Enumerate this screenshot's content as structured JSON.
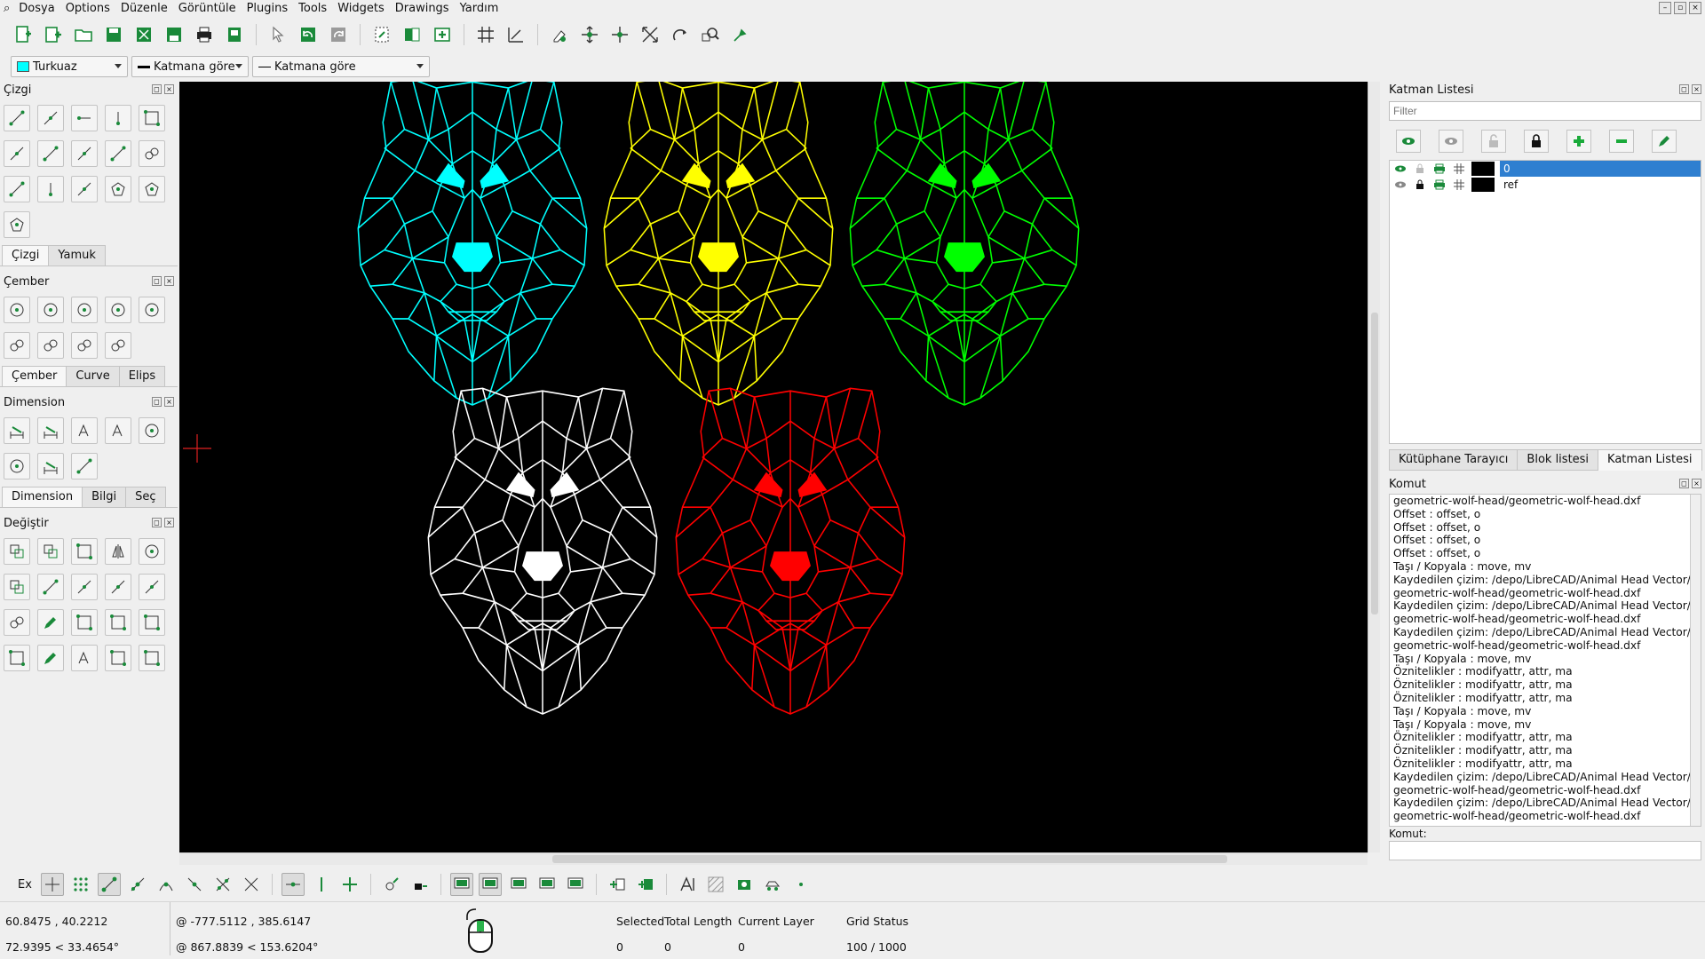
{
  "menu": [
    "Dosya",
    "Options",
    "Düzenle",
    "Görüntüle",
    "Plugins",
    "Tools",
    "Widgets",
    "Drawings",
    "Yardım"
  ],
  "toolbar2": {
    "color": "Turkuaz",
    "color_hex": "#00ffff",
    "linewidth": "Katmana göre",
    "linetype": "Katmana göre"
  },
  "left_dock": {
    "cizgi_title": "Çizgi",
    "cizgi_tabs": [
      "Çizgi",
      "Yamuk"
    ],
    "cember_title": "Çember",
    "cember_tabs": [
      "Çember",
      "Curve",
      "Elips"
    ],
    "dimension_title": "Dimension",
    "dimension_tabs": [
      "Dimension",
      "Bilgi",
      "Seç"
    ],
    "degistir_title": "Değiştir"
  },
  "layers": {
    "title": "Katman Listesi",
    "filter_placeholder": "Filter",
    "rows": [
      {
        "name": "0",
        "selected": true
      },
      {
        "name": "ref",
        "selected": false
      }
    ],
    "tabs": [
      "Kütüphane Tarayıcı",
      "Blok listesi",
      "Katman Listesi"
    ]
  },
  "command": {
    "title": "Komut",
    "log": [
      "geometric-wolf-head/geometric-wolf-head.dxf",
      "Offset : offset, o",
      "Offset : offset, o",
      "Offset : offset, o",
      "Offset : offset, o",
      "Taşı / Kopyala : move, mv",
      "Kaydedilen çizim: /depo/LibreCAD/Animal Head Vector/",
      "geometric-wolf-head/geometric-wolf-head.dxf",
      "Kaydedilen çizim: /depo/LibreCAD/Animal Head Vector/",
      "geometric-wolf-head/geometric-wolf-head.dxf",
      "Kaydedilen çizim: /depo/LibreCAD/Animal Head Vector/",
      "geometric-wolf-head/geometric-wolf-head.dxf",
      "Taşı / Kopyala : move, mv",
      "Öznitelikler : modifyattr, attr, ma",
      "Öznitelikler : modifyattr, attr, ma",
      "Öznitelikler : modifyattr, attr, ma",
      "Taşı / Kopyala : move, mv",
      "Taşı / Kopyala : move, mv",
      "Öznitelikler : modifyattr, attr, ma",
      "Öznitelikler : modifyattr, attr, ma",
      "Öznitelikler : modifyattr, attr, ma",
      "Kaydedilen çizim: /depo/LibreCAD/Animal Head Vector/",
      "geometric-wolf-head/geometric-wolf-head.dxf",
      "Kaydedilen çizim: /depo/LibreCAD/Animal Head Vector/",
      "geometric-wolf-head/geometric-wolf-head.dxf"
    ],
    "input_label": "Komut:"
  },
  "bottom": {
    "ex_label": "Ex"
  },
  "status": {
    "coord_abs": "60.8475 , 40.2212",
    "coord_polar": "72.9395 < 33.4654°",
    "rel_abs": "@  -777.5112 , 385.6147",
    "rel_polar": "@  867.8839 < 153.6204°",
    "selected_label": "Selected",
    "selected_value": "0",
    "total_length_label": "Total Length",
    "total_length_value": "0",
    "current_layer_label": "Current Layer",
    "current_layer_value": "0",
    "grid_status_label": "Grid Status",
    "grid_status_value": "100 / 1000"
  },
  "wolves": [
    {
      "color": "#00ffff"
    },
    {
      "color": "#ffff00"
    },
    {
      "color": "#00ff00"
    },
    {
      "color": "#ffffff"
    },
    {
      "color": "#ff0000"
    }
  ]
}
